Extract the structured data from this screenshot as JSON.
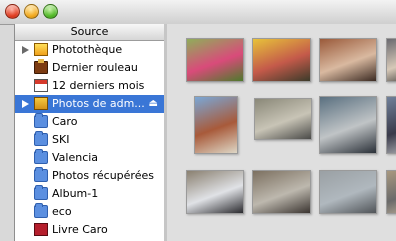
{
  "window": {
    "title": ""
  },
  "sidebar": {
    "header": "Source",
    "items": [
      {
        "label": "Photothèque",
        "icon": "library-icon",
        "expandable": true,
        "selected": false
      },
      {
        "label": "Dernier rouleau",
        "icon": "film-roll-icon",
        "expandable": false,
        "selected": false
      },
      {
        "label": "12 derniers mois",
        "icon": "calendar-icon",
        "expandable": false,
        "selected": false
      },
      {
        "label": "Photos de adm...",
        "icon": "shared-library-icon",
        "expandable": true,
        "selected": true,
        "eject": "⏏"
      },
      {
        "label": "Caro",
        "icon": "album-folder-icon"
      },
      {
        "label": "SKI",
        "icon": "album-folder-icon"
      },
      {
        "label": "Valencia",
        "icon": "album-folder-icon"
      },
      {
        "label": "Photos récupérées",
        "icon": "album-folder-icon"
      },
      {
        "label": "Album-1",
        "icon": "album-folder-icon"
      },
      {
        "label": "eco",
        "icon": "album-folder-icon"
      },
      {
        "label": "Livre Caro",
        "icon": "book-icon"
      }
    ]
  },
  "photos": [
    {
      "name": "photo-thumbnail",
      "colors": [
        "#8fae5a",
        "#d94b7a",
        "#4d7a2c"
      ]
    },
    {
      "name": "photo-thumbnail",
      "colors": [
        "#e7c23a",
        "#c45a4a",
        "#3b3b2a"
      ]
    },
    {
      "name": "photo-thumbnail",
      "colors": [
        "#9a5a3a",
        "#d9b9a0",
        "#3b2a22"
      ]
    },
    {
      "name": "photo-thumbnail",
      "colors": [
        "#6a6a70",
        "#d7c9b8",
        "#2a2a2a"
      ]
    },
    {
      "name": "photo-thumbnail",
      "colors": [
        "#7aa7d6",
        "#a85a3a",
        "#ded7c6"
      ]
    },
    {
      "name": "photo-thumbnail",
      "colors": [
        "#8a8878",
        "#c8c4b6",
        "#4a4a48"
      ]
    },
    {
      "name": "photo-thumbnail",
      "colors": [
        "#5a7080",
        "#c0c4c6",
        "#2a3038"
      ]
    },
    {
      "name": "photo-thumbnail",
      "colors": [
        "#70809a",
        "#3a3a4a",
        "#c4c6c8"
      ]
    },
    {
      "name": "photo-thumbnail",
      "colors": [
        "#8a8070",
        "#e0e2e6",
        "#2a2a2e"
      ]
    },
    {
      "name": "photo-thumbnail",
      "colors": [
        "#7c7060",
        "#bdb8ae",
        "#3a3430"
      ]
    },
    {
      "name": "photo-thumbnail",
      "colors": [
        "#9aa0a4",
        "#b0b8be",
        "#505458"
      ]
    },
    {
      "name": "photo-thumbnail",
      "colors": [
        "#a89880",
        "#6a6a6a",
        "#c8b8a0"
      ]
    }
  ],
  "colors": {
    "selection": "#3a76d6",
    "folder": "#5b8fe0"
  }
}
